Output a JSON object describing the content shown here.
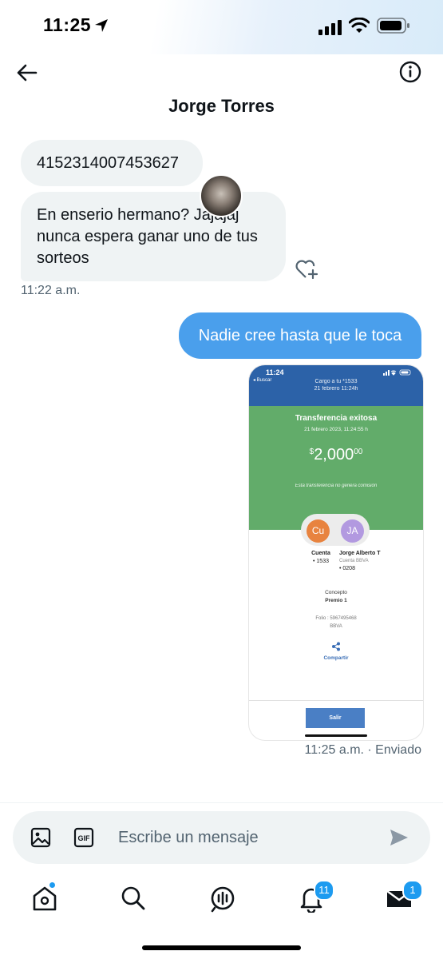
{
  "status_bar": {
    "time": "11:25"
  },
  "header": {
    "title": "Jorge Torres"
  },
  "messages": {
    "incoming": [
      {
        "text": "4152314007453627"
      },
      {
        "text": "En enserio hermano? Jajajaj nunca espera ganar uno de tus sorteos"
      }
    ],
    "incoming_time": "11:22 a.m.",
    "outgoing": {
      "text": "Nadie cree hasta que le toca"
    },
    "outgoing_time": "11:25 a.m. · Enviado"
  },
  "attachment": {
    "time": "11:24",
    "back": "◂ Buscar",
    "header_line1": "Cargo a tu *1533",
    "header_line2": "21 febrero 11:24h",
    "title": "Transferencia exitosa",
    "date": "21 febrero 2023, 11:24:55 h",
    "currency": "$",
    "amount": "2,000",
    "cents": "00",
    "note": "Esta transferencia no genera comisión",
    "from_initials": "Cu",
    "to_initials": "JA",
    "from_label": "Cuenta",
    "from_account": "• 1533",
    "to_name": "Jorge Alberto T",
    "to_bank": "Cuenta BBVA",
    "to_account": "• 0208",
    "concept_label": "Concepto",
    "concept_value": "Premio 1",
    "folio": "Folio : 5967495468",
    "bank": "BBVA",
    "share_label": "Compartir",
    "exit_label": "Salir"
  },
  "composer": {
    "placeholder": "Escribe un mensaje"
  },
  "tabs": {
    "notifications_badge": "11",
    "messages_badge": "1"
  },
  "colors": {
    "accent": "#1d9bf0",
    "outgoing_bubble": "#4a9fec",
    "incoming_bubble": "#eff3f4",
    "bank_blue": "#2c62a8",
    "bank_green": "#62ac6a"
  },
  "icons": [
    "location-arrow-icon",
    "signal-icon",
    "wifi-icon",
    "battery-icon",
    "back-arrow-icon",
    "info-icon",
    "add-reaction-icon",
    "image-icon",
    "gif-icon",
    "send-icon",
    "home-icon",
    "search-icon",
    "spaces-icon",
    "bell-icon",
    "mail-icon",
    "share-icon"
  ]
}
